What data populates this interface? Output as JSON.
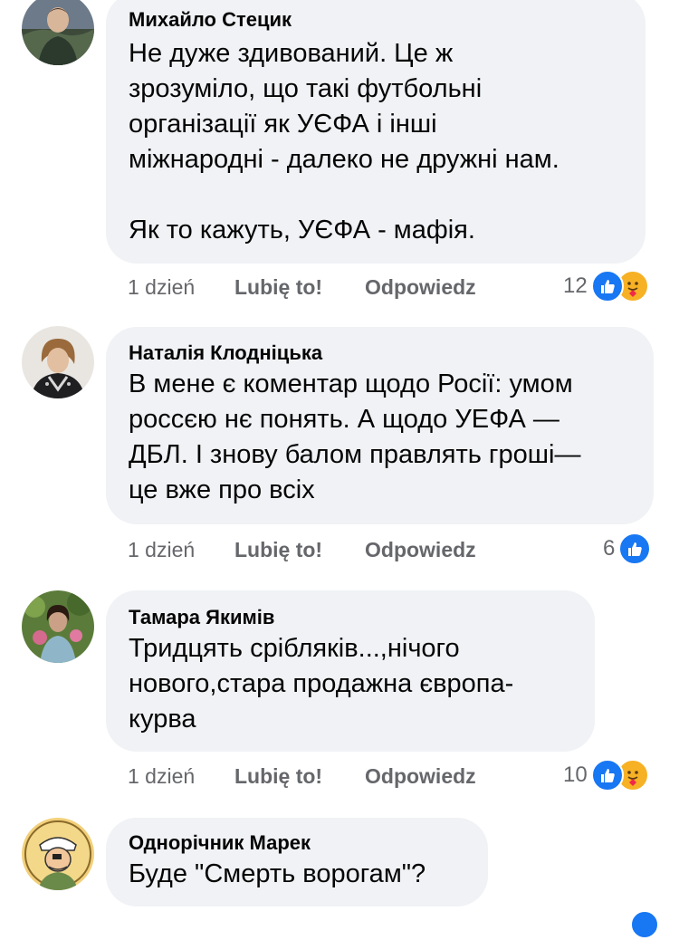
{
  "comments": [
    {
      "author": "Михайло Стецик",
      "text": "Не дуже здивований. Це ж\nзрозуміло, що такі футбольні\nорганізації як УЄФА і інші\nміжнародні - далеко не дружні нам.\n\nЯк то кажуть, УЄФА - мафія.",
      "time": "1 dzień",
      "like_label": "Lubię to!",
      "reply_label": "Odpowiedz",
      "reaction_count": "12",
      "reactions": [
        "like-icon",
        "care-icon"
      ]
    },
    {
      "author": "Наталія Клодніцька",
      "text": "В мене є коментар щодо Росії: умом\nроссєю нє понять. А щодо УЕФА —\nДБЛ. І знову балом правлять гроші—\nце вже про всіх",
      "time": "1 dzień",
      "like_label": "Lubię to!",
      "reply_label": "Odpowiedz",
      "reaction_count": "6",
      "reactions": [
        "like-icon"
      ]
    },
    {
      "author": "Тамара Якимів",
      "text": "Тридцять срібляків...,нічого\nнового,стара продажна європа-\nкурва",
      "time": "1 dzień",
      "like_label": "Lubię to!",
      "reply_label": "Odpowiedz",
      "reaction_count": "10",
      "reactions": [
        "like-icon",
        "care-icon"
      ]
    },
    {
      "author": "Однорічник Марек",
      "text": "Буде \"Смерть ворогам\"?",
      "reactions": []
    }
  ],
  "colors": {
    "bubble": "#f0f2f5",
    "like_blue": "#1877f2",
    "care_yellow": "#f7b125",
    "meta_gray": "#65676b"
  }
}
